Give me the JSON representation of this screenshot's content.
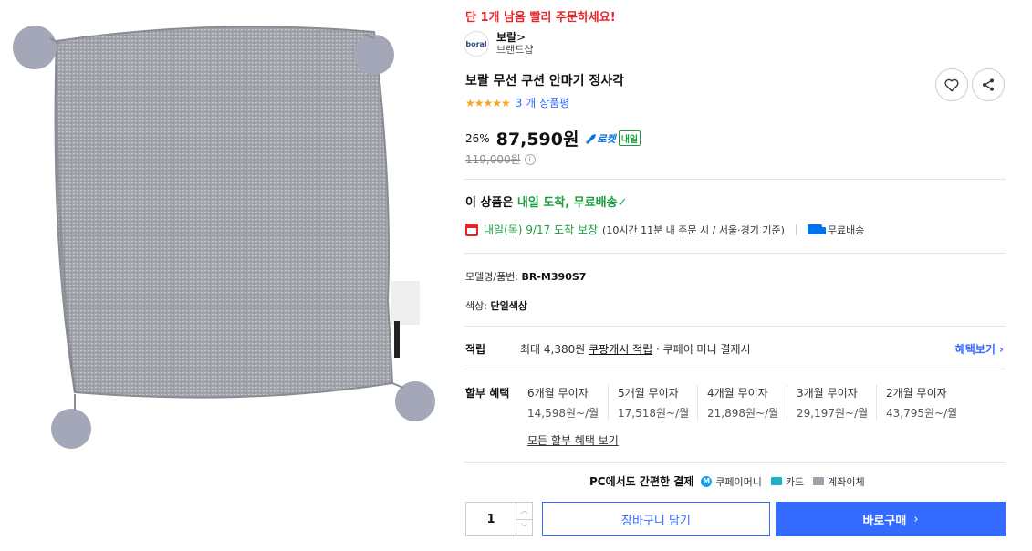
{
  "urgency": "단 1개 남음 빨리 주문하세요!",
  "brand": {
    "logo_text": "boral",
    "name": "보랄",
    "chevron": ">",
    "sub": "브랜드샵"
  },
  "product": {
    "title": "보랄 무선 쿠션 안마기 정사각",
    "stars": "★★★★★",
    "review_count": "3 개 상품평",
    "discount": "26%",
    "price": "87,590원",
    "rocket_label": "로켓",
    "rocket_badge": "내일",
    "original_price": "119,000원",
    "info_glyph": "i"
  },
  "delivery": {
    "headline_prefix": "이 상품은 ",
    "headline_highlight": "내일 도착, 무료배송",
    "headline_check": "✓",
    "arrival": "내일(목) 9/17 도착 보장",
    "arrival_note": "(10시간 11분 내 주문 시 / 서울·경기 기준)",
    "free_shipping": "무료배송"
  },
  "specs": {
    "model_label": "모델명/품번:",
    "model_value": "BR-M390S7",
    "color_label": "색상:",
    "color_value": "단일색상"
  },
  "reward": {
    "label": "적립",
    "prefix": "최대 4,380원 ",
    "link": "쿠팡캐시 적립",
    "suffix": " · 쿠페이 머니 결제시",
    "benefit_link": "혜택보기 ›"
  },
  "installment": {
    "label": "할부 혜택",
    "plans": [
      {
        "title": "6개월 무이자",
        "amount": "14,598원~/월"
      },
      {
        "title": "5개월 무이자",
        "amount": "17,518원~/월"
      },
      {
        "title": "4개월 무이자",
        "amount": "21,898원~/월"
      },
      {
        "title": "3개월 무이자",
        "amount": "29,197원~/월"
      },
      {
        "title": "2개월 무이자",
        "amount": "43,795원~/월"
      }
    ],
    "all_link": "모든 할부 혜택 보기"
  },
  "payment": {
    "title": "PC에서도 간편한 결제",
    "coupay_glyph": "M",
    "coupay": "쿠페이머니",
    "card": "카드",
    "bank": "계좌이체"
  },
  "purchase": {
    "quantity": "1",
    "up": "︿",
    "down": "﹀",
    "cart_label": "장바구니 담기",
    "buy_label": "바로구매",
    "buy_arrow": "›"
  },
  "colors": {
    "accent": "#346aff",
    "urgent": "#e52528",
    "delivery_green": "#1b9e3c",
    "rocket_blue": "#0074e9",
    "star": "#f5a623",
    "pillow": "#a7a9b0"
  }
}
